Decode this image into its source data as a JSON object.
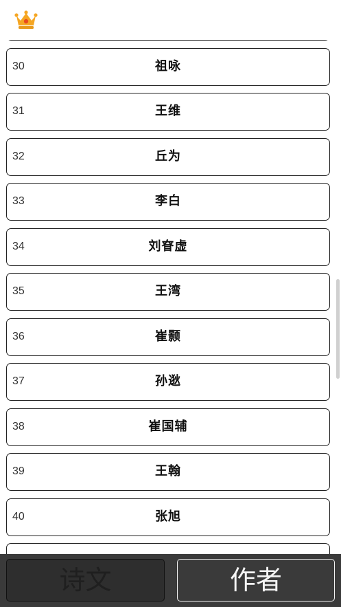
{
  "header": {
    "crown_icon": "crown-icon",
    "colors": {
      "crown_gold": "#f5a623",
      "crown_gem": "#e8491d"
    }
  },
  "list": {
    "items": [
      {
        "num": "",
        "name": ""
      },
      {
        "num": "30",
        "name": "祖咏"
      },
      {
        "num": "31",
        "name": "王维"
      },
      {
        "num": "32",
        "name": "丘为"
      },
      {
        "num": "33",
        "name": "李白"
      },
      {
        "num": "34",
        "name": "刘眘虚"
      },
      {
        "num": "35",
        "name": "王湾"
      },
      {
        "num": "36",
        "name": "崔颢"
      },
      {
        "num": "37",
        "name": "孙逖"
      },
      {
        "num": "38",
        "name": "崔国辅"
      },
      {
        "num": "39",
        "name": "王翰"
      },
      {
        "num": "40",
        "name": "张旭"
      },
      {
        "num": "",
        "name": ""
      }
    ]
  },
  "tabs": {
    "poems_label": "诗文",
    "authors_label": "作者",
    "selected": "作者"
  },
  "colors": {
    "bottom_bar": "#3a3a3a",
    "row_border": "#222222"
  }
}
